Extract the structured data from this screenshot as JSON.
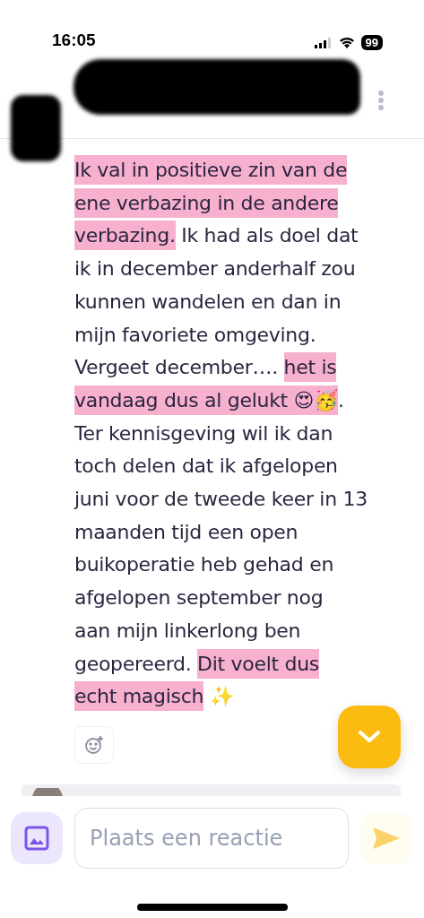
{
  "status_bar": {
    "time": "16:05",
    "battery": "99"
  },
  "message": {
    "lines": [
      [
        {
          "text": "Ik val in positieve zin van de",
          "highlighted": true
        }
      ],
      [
        {
          "text": "ene verbazing in de andere",
          "highlighted": true
        }
      ],
      [
        {
          "text": "verbazing.",
          "highlighted": true
        },
        {
          "text": " Ik had als doel dat",
          "highlighted": false
        }
      ],
      [
        {
          "text": "ik in december anderhalf zou",
          "highlighted": false
        }
      ],
      [
        {
          "text": "kunnen wandelen en dan in",
          "highlighted": false
        }
      ],
      [
        {
          "text": "mijn favoriete omgeving.",
          "highlighted": false
        }
      ],
      [
        {
          "text": "Vergeet december…. ",
          "highlighted": false
        },
        {
          "text": "het is",
          "highlighted": true
        }
      ],
      [
        {
          "text": "vandaag dus al gelukt 😍🥳",
          "highlighted": true
        },
        {
          "text": ".",
          "highlighted": false
        }
      ],
      [
        {
          "text": "Ter kennisgeving wil ik dan",
          "highlighted": false
        }
      ],
      [
        {
          "text": "toch delen dat ik afgelopen",
          "highlighted": false
        }
      ],
      [
        {
          "text": "juni voor de tweede keer in 13",
          "highlighted": false
        }
      ],
      [
        {
          "text": "maanden tijd een open",
          "highlighted": false
        }
      ],
      [
        {
          "text": "buikoperatie heb gehad en",
          "highlighted": false
        }
      ],
      [
        {
          "text": "afgelopen september nog",
          "highlighted": false
        }
      ],
      [
        {
          "text": "aan mijn linkerlong ben",
          "highlighted": false
        }
      ],
      [
        {
          "text": "geopereerd. ",
          "highlighted": false
        },
        {
          "text": "Dit voelt dus",
          "highlighted": true
        }
      ],
      [
        {
          "text": "echt magisch",
          "highlighted": true
        },
        {
          "text": " ✨",
          "highlighted": false
        }
      ]
    ]
  },
  "composer": {
    "placeholder": "Plaats een reactie"
  }
}
